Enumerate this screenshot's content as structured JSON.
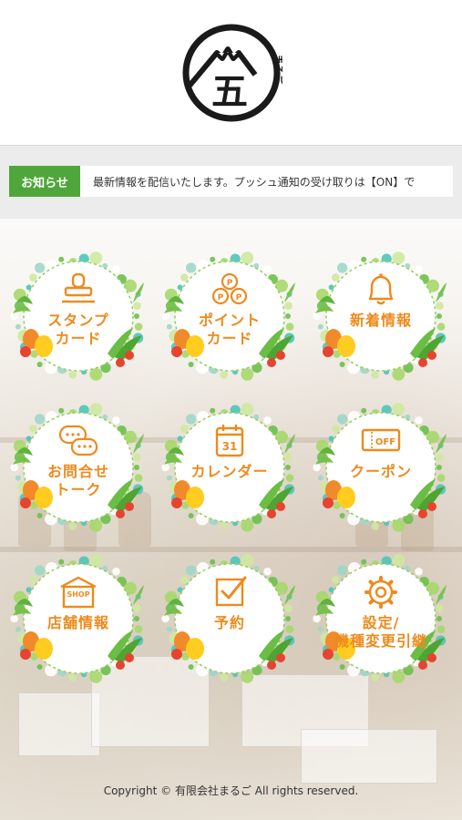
{
  "header": {
    "logo_text": "まるご",
    "logo_kanji": "五"
  },
  "news": {
    "label": "お知らせ",
    "text": "最新情報を配信いたします。プッシュ通知の受け取りは【ON】で"
  },
  "menu": [
    {
      "label": "スタンプ\nカード",
      "icon": "stamp-icon",
      "icon_text": ""
    },
    {
      "label": "ポイント\nカード",
      "icon": "point-coins-icon",
      "icon_text": "P"
    },
    {
      "label": "新着情報",
      "icon": "bell-icon",
      "icon_text": ""
    },
    {
      "label": "お問合せ\nトーク",
      "icon": "chat-bubbles-icon",
      "icon_text": ""
    },
    {
      "label": "カレンダー",
      "icon": "calendar-icon",
      "icon_text": "31"
    },
    {
      "label": "クーポン",
      "icon": "coupon-ticket-icon",
      "icon_text": "OFF"
    },
    {
      "label": "店舗情報",
      "icon": "shop-icon",
      "icon_text": "SHOP"
    },
    {
      "label": "予約",
      "icon": "checkbox-icon",
      "icon_text": ""
    },
    {
      "label": "設定/\n機種変更引継",
      "icon": "gear-icon",
      "icon_text": ""
    }
  ],
  "footer": {
    "copyright": "Copyright © 有限会社まるご All rights reserved."
  },
  "colors": {
    "accent": "#ee8a1c",
    "news_label_bg": "#4fa63a",
    "wreath_green": "#6cc04a",
    "wreath_teal": "#4fc4b8"
  }
}
